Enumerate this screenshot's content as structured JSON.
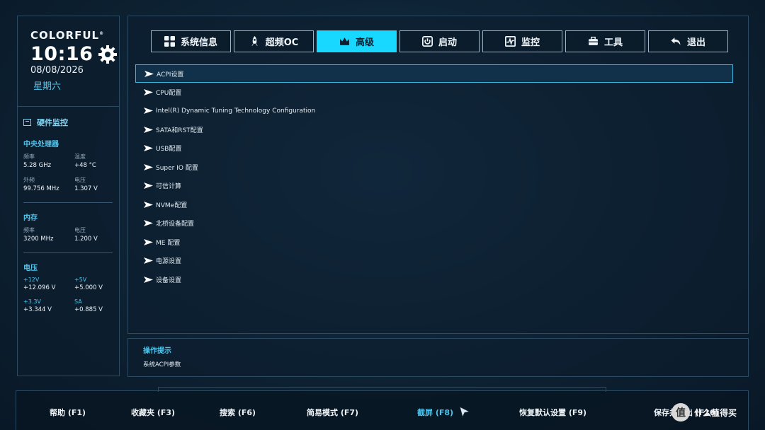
{
  "brand": "COLORFUL",
  "brand_reg": "®",
  "clock": {
    "time": "10:16",
    "date": "08/08/2026",
    "weekday": "星期六"
  },
  "monitor": {
    "title": "硬件监控",
    "cpu": {
      "heading": "中央处理器",
      "freq_label": "频率",
      "freq_value": "5.28 GHz",
      "temp_label": "温度",
      "temp_value": "+48 °C",
      "bclk_label": "外频",
      "bclk_value": "99.756 MHz",
      "volt_label": "电压",
      "volt_value": "1.307 V"
    },
    "memory": {
      "heading": "内存",
      "freq_label": "频率",
      "freq_value": "3200 MHz",
      "volt_label": "电压",
      "volt_value": "1.200 V"
    },
    "voltage": {
      "heading": "电压",
      "v12_label": "+12V",
      "v12_value": "+12.096 V",
      "v5_label": "+5V",
      "v5_value": "+5.000 V",
      "v33_label": "+3.3V",
      "v33_value": "+3.344 V",
      "sa_label": "SA",
      "sa_value": "+0.885 V"
    }
  },
  "tabs": [
    {
      "label": "系统信息",
      "icon": "grid-icon"
    },
    {
      "label": "超频OC",
      "icon": "rocket-icon"
    },
    {
      "label": "高级",
      "icon": "crown-icon",
      "active": true
    },
    {
      "label": "启动",
      "icon": "power-icon"
    },
    {
      "label": "监控",
      "icon": "pulse-icon"
    },
    {
      "label": "工具",
      "icon": "toolbox-icon"
    },
    {
      "label": "退出",
      "icon": "back-arrow-icon"
    }
  ],
  "menu": [
    "ACPI设置",
    "CPU配置",
    "Intel(R) Dynamic Tuning Technology Configuration",
    "SATA和RST配置",
    "USB配置",
    "Super IO 配置",
    "可信计算",
    "NVMe配置",
    "北桥设备配置",
    "ME 配置",
    "电源设置",
    "设备设置"
  ],
  "help": {
    "title": "操作提示",
    "text": "系统ACPI参数"
  },
  "fkeys": [
    {
      "label": "帮助 (F1)"
    },
    {
      "label": "收藏夹 (F3)"
    },
    {
      "label": "搜索 (F6)"
    },
    {
      "label": "简易模式 (F7)"
    },
    {
      "label": "截屏 (F8)",
      "highlight": true
    },
    {
      "label": "恢复默认设置 (F9)"
    },
    {
      "label": "保存并退出 (F10)"
    }
  ],
  "watermark": {
    "text": "什么值得买",
    "badge": "值"
  },
  "colors": {
    "accent": "#19d8ff",
    "highlight_text": "#4cc6ee",
    "panel_border": "#2c4a62"
  }
}
